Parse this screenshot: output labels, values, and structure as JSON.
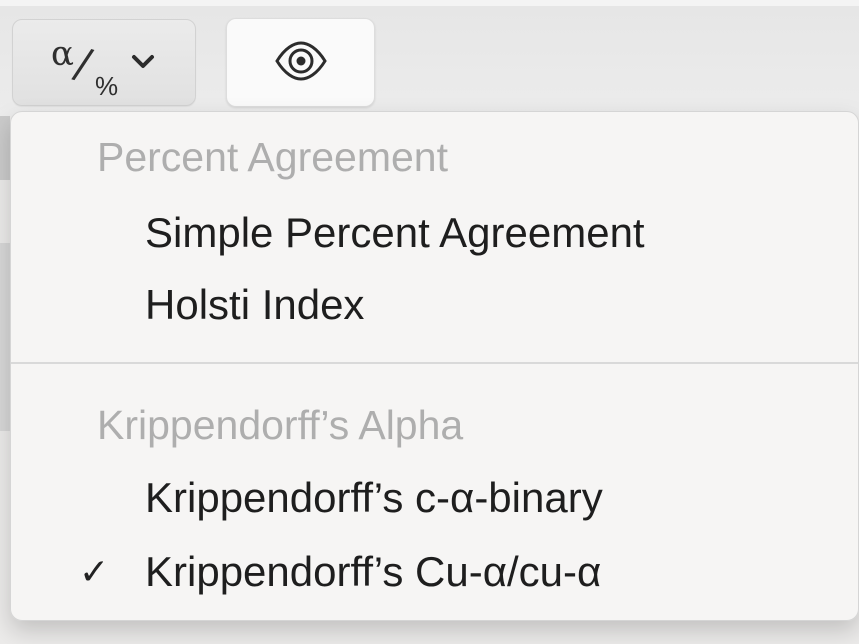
{
  "toolbar": {
    "metric_button": {
      "alpha_symbol": "α",
      "slash_symbol": "/",
      "percent_symbol": "%",
      "icon": "alpha-percent-icon",
      "chevron_icon": "chevron-down-icon"
    },
    "view_button": {
      "icon": "eye-icon"
    }
  },
  "menu": {
    "sections": [
      {
        "header": "Percent Agreement",
        "items": [
          {
            "label": "Simple Percent Agreement",
            "checked": false
          },
          {
            "label": "Holsti Index",
            "checked": false
          }
        ]
      },
      {
        "header": "Krippendorff’s Alpha",
        "items": [
          {
            "label": "Krippendorff’s c-α-binary",
            "checked": false
          },
          {
            "label": "Krippendorff’s Cu-α/cu-α",
            "checked": true,
            "check_mark": "✓"
          }
        ]
      }
    ]
  },
  "colors": {
    "toolbar_background": "#ececec",
    "menu_background": "#f6f5f4",
    "header_text": "#aeaeae",
    "item_text": "#1e1e1e",
    "divider": "#d9d9d9"
  }
}
